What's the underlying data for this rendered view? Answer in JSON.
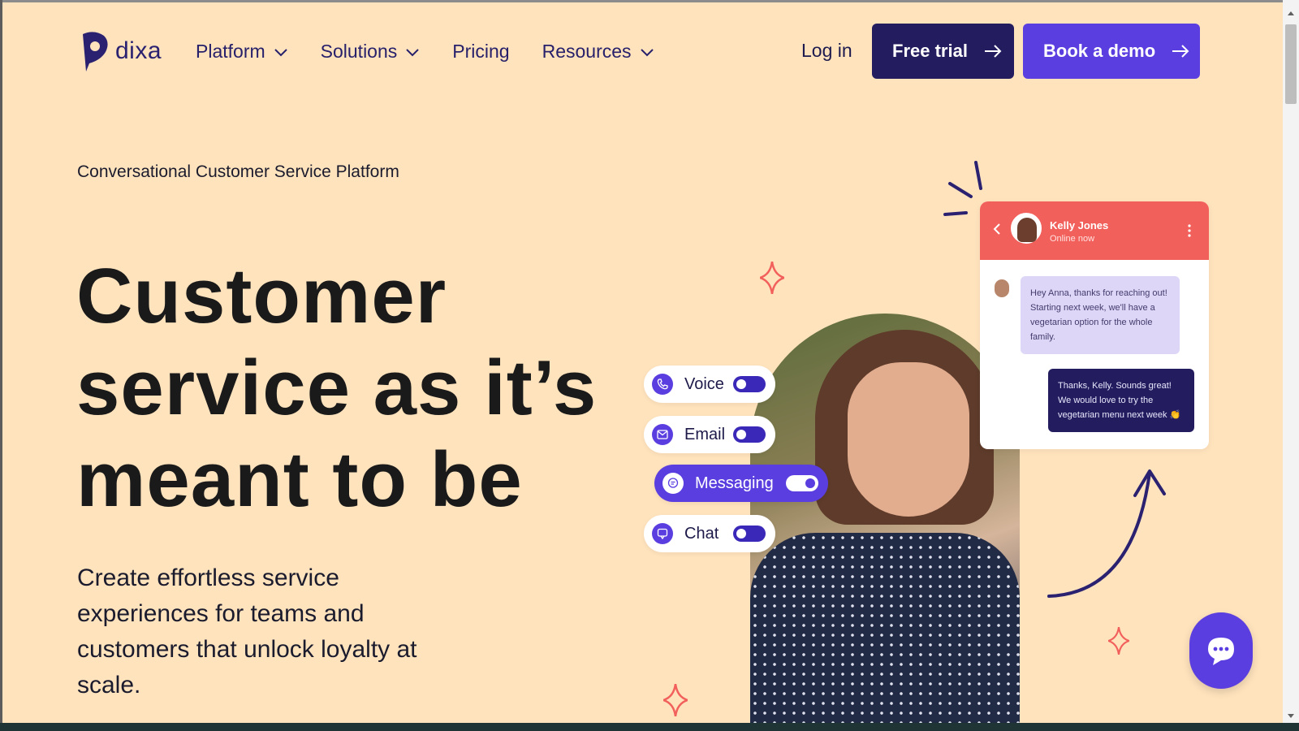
{
  "brand": {
    "name": "dixa",
    "color": "#5b3ee0",
    "dark": "#231d60",
    "accent": "#f2605c"
  },
  "nav": {
    "items": [
      {
        "label": "Platform",
        "has_menu": true
      },
      {
        "label": "Solutions",
        "has_menu": true
      },
      {
        "label": "Pricing",
        "has_menu": false
      },
      {
        "label": "Resources",
        "has_menu": true
      }
    ],
    "login_label": "Log in",
    "free_trial_label": "Free trial",
    "book_demo_label": "Book a demo"
  },
  "hero": {
    "eyebrow": "Conversational Customer Service Platform",
    "headline": "Customer service as it’s meant to be",
    "subheadline": "Create effortless service experiences for teams and customers that unlock loyalty at scale."
  },
  "channels": [
    {
      "label": "Voice",
      "icon": "phone-icon",
      "enabled": false
    },
    {
      "label": "Email",
      "icon": "mail-icon",
      "enabled": false
    },
    {
      "label": "Messaging",
      "icon": "message-icon",
      "enabled": true
    },
    {
      "label": "Chat",
      "icon": "chat-icon",
      "enabled": false
    }
  ],
  "chat_card": {
    "contact_name": "Kelly Jones",
    "contact_status": "Online now",
    "incoming_message": "Hey Anna, thanks for reaching out! Starting next week, we'll have a vegetarian option for the whole family.",
    "outgoing_message": "Thanks, Kelly. Sounds great! We would love to try the vegetarian menu next week 👏"
  },
  "chat_launcher": {
    "icon": "chat-bubble-icon"
  }
}
